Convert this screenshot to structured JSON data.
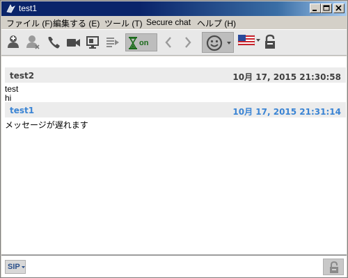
{
  "window": {
    "title": "test1"
  },
  "menu": [
    {
      "label": "ファイル (F)"
    },
    {
      "label": "編集する (E)"
    },
    {
      "label": "ツール (T)"
    },
    {
      "label": "Secure chat"
    },
    {
      "label": "ヘルプ (H)"
    }
  ],
  "toolbar": {
    "hourglass_label": "on"
  },
  "messages": [
    {
      "sender": "test2",
      "timestamp": "10月 17, 2015 21:30:58",
      "lines": [
        "test",
        "hi"
      ]
    },
    {
      "sender": "test1",
      "timestamp": "10月 17, 2015 21:31:14",
      "lines": [
        "メッセージが遅れます"
      ]
    }
  ],
  "input": {
    "protocol_label": "SIP"
  },
  "colors": {
    "self_accent": "#3a84d4",
    "peer_text": "#404040",
    "titlebar": "#0a246a"
  }
}
